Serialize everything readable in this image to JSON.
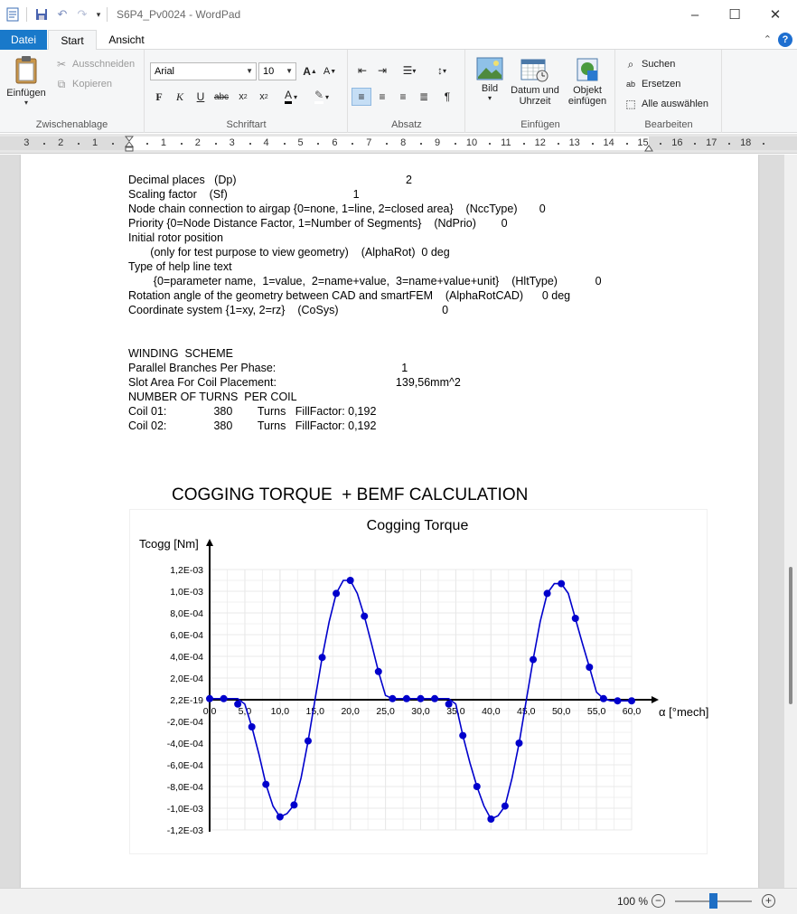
{
  "window": {
    "title": "S6P4_Pv0024 - WordPad"
  },
  "quick_access": {
    "icons": [
      "wordpad-app-icon",
      "save-icon",
      "undo-icon",
      "redo-icon",
      "customize-dropdown-icon"
    ]
  },
  "window_controls": {
    "minimize": "–",
    "maximize": "☐",
    "close": "✕"
  },
  "tabs": {
    "file": "Datei",
    "home": "Start",
    "view": "Ansicht"
  },
  "ribbon": {
    "clipboard": {
      "label": "Zwischenablage",
      "paste": "Einfügen",
      "cut": "Ausschneiden",
      "copy": "Kopieren"
    },
    "font": {
      "label": "Schriftart",
      "family": "Arial",
      "size": "10"
    },
    "paragraph": {
      "label": "Absatz"
    },
    "insert": {
      "label": "Einfügen",
      "picture": "Bild",
      "datetime_line1": "Datum und",
      "datetime_line2": "Uhrzeit",
      "object_line1": "Objekt",
      "object_line2": "einfügen"
    },
    "edit": {
      "label": "Bearbeiten",
      "find": "Suchen",
      "replace": "Ersetzen",
      "select_all": "Alle auswählen"
    }
  },
  "ruler": {
    "numbers": [
      "3",
      "2",
      "1",
      "1",
      "2",
      "3",
      "4",
      "5",
      "6",
      "7",
      "8",
      "9",
      "10",
      "11",
      "12",
      "13",
      "14",
      "15",
      "16",
      "17",
      "18"
    ]
  },
  "document": {
    "lines": [
      "Decimal places   (Dp)                                                      2",
      "Scaling factor    (Sf)                                        1",
      "Node chain connection to airgap {0=none, 1=line, 2=closed area}    (NccType)       0",
      "Priority {0=Node Distance Factor, 1=Number of Segments}    (NdPrio)        0",
      "Initial rotor position",
      "       (only for test purpose to view geometry)    (AlphaRot)  0 deg",
      "Type of help line text",
      "        {0=parameter name,  1=value,  2=name+value,  3=name+value+unit}    (HltType)            0",
      "Rotation angle of the geometry between CAD and smartFEM    (AlphaRotCAD)      0 deg",
      "Coordinate system {1=xy, 2=rz}    (CoSys)                                 0",
      "",
      "",
      "WINDING  SCHEME",
      "Parallel Branches Per Phase:                                        1",
      "Slot Area For Coil Placement:                                      139,56mm^2",
      "NUMBER OF TURNS  PER COIL",
      "Coil 01:               380        Turns   FillFactor: 0,192",
      "Coil 02:               380        Turns   FillFactor: 0,192"
    ],
    "heading": "COGGING TORQUE  + BEMF CALCULATION"
  },
  "chart_data": {
    "type": "scatter",
    "title": "Cogging Torque",
    "ylabel": "Tcogg [Nm]",
    "xlabel": "α [°mech]",
    "x_ticks": [
      "0,0",
      "5,0",
      "10,0",
      "15,0",
      "20,0",
      "25,0",
      "30,0",
      "35,0",
      "40,0",
      "45,0",
      "50,0",
      "55,0",
      "60,0"
    ],
    "x_tick_values": [
      0,
      5,
      10,
      15,
      20,
      25,
      30,
      35,
      40,
      45,
      50,
      55,
      60
    ],
    "y_ticks": [
      "1,2E-03",
      "1,0E-03",
      "8,0E-04",
      "6,0E-04",
      "4,0E-04",
      "2,0E-04",
      "2,2E-19",
      "-2,0E-04",
      "-4,0E-04",
      "-6,0E-04",
      "-8,0E-04",
      "-1,0E-03",
      "-1,2E-03"
    ],
    "y_tick_values": [
      0.0012,
      0.001,
      0.0008,
      0.0006,
      0.0004,
      0.0002,
      0,
      -0.0002,
      -0.0004,
      -0.0006,
      -0.0008,
      -0.001,
      -0.0012
    ],
    "xlim": [
      0,
      60
    ],
    "ylim": [
      -0.0012,
      0.0012
    ],
    "grid": true,
    "series": [
      {
        "color": "#0000cc",
        "x": [
          0,
          1,
          2,
          3,
          4,
          5,
          6,
          7,
          8,
          9,
          10,
          11,
          12,
          13,
          14,
          15,
          16,
          17,
          18,
          19,
          20,
          21,
          22,
          23,
          24,
          25,
          26,
          27,
          28,
          29,
          30,
          31,
          32,
          33,
          34,
          35,
          36,
          37,
          38,
          39,
          40,
          41,
          42,
          43,
          44,
          45,
          46,
          47,
          48,
          49,
          50,
          51,
          52,
          53,
          54,
          55,
          56,
          57,
          58,
          59,
          60
        ],
        "y": [
          1e-05,
          1e-05,
          1e-05,
          1e-05,
          1e-05,
          -4e-05,
          -0.00025,
          -0.0005,
          -0.00078,
          -0.00098,
          -0.00108,
          -0.00105,
          -0.00097,
          -0.00072,
          -0.00038,
          1e-05,
          0.00039,
          0.00072,
          0.00098,
          0.0011,
          0.0011,
          0.00098,
          0.00077,
          0.00052,
          0.00026,
          4e-05,
          1e-05,
          1e-05,
          1e-05,
          1e-05,
          1e-05,
          1e-05,
          1e-05,
          1e-05,
          1e-05,
          -4e-05,
          -0.00033,
          -0.00058,
          -0.0008,
          -0.00098,
          -0.0011,
          -0.00107,
          -0.00098,
          -0.00072,
          -0.0004,
          -1e-05,
          0.00037,
          0.00072,
          0.00098,
          0.00107,
          0.00107,
          0.00098,
          0.00075,
          0.00052,
          0.0003,
          7e-05,
          1e-05,
          -1e-05,
          -1e-05,
          -1e-05,
          -1e-05
        ],
        "markers_x": [
          0,
          2,
          4,
          6,
          8,
          10,
          12,
          14,
          16,
          18,
          20,
          22,
          24,
          26,
          28,
          30,
          32,
          34,
          36,
          38,
          40,
          42,
          44,
          46,
          48,
          50,
          52,
          54,
          56,
          58,
          60
        ],
        "markers_y": [
          1e-05,
          1e-05,
          -4e-05,
          -0.00025,
          -0.00078,
          -0.00108,
          -0.00097,
          -0.00038,
          0.00039,
          0.00098,
          0.0011,
          0.00077,
          0.00026,
          1e-05,
          1e-05,
          1e-05,
          1e-05,
          -4e-05,
          -0.00033,
          -0.0008,
          -0.0011,
          -0.00098,
          -0.0004,
          0.00037,
          0.00098,
          0.00107,
          0.00075,
          0.0003,
          1e-05,
          -1e-05,
          -1e-05
        ]
      }
    ]
  },
  "status": {
    "zoom": "100 %",
    "zoom_level_percent": 50
  }
}
